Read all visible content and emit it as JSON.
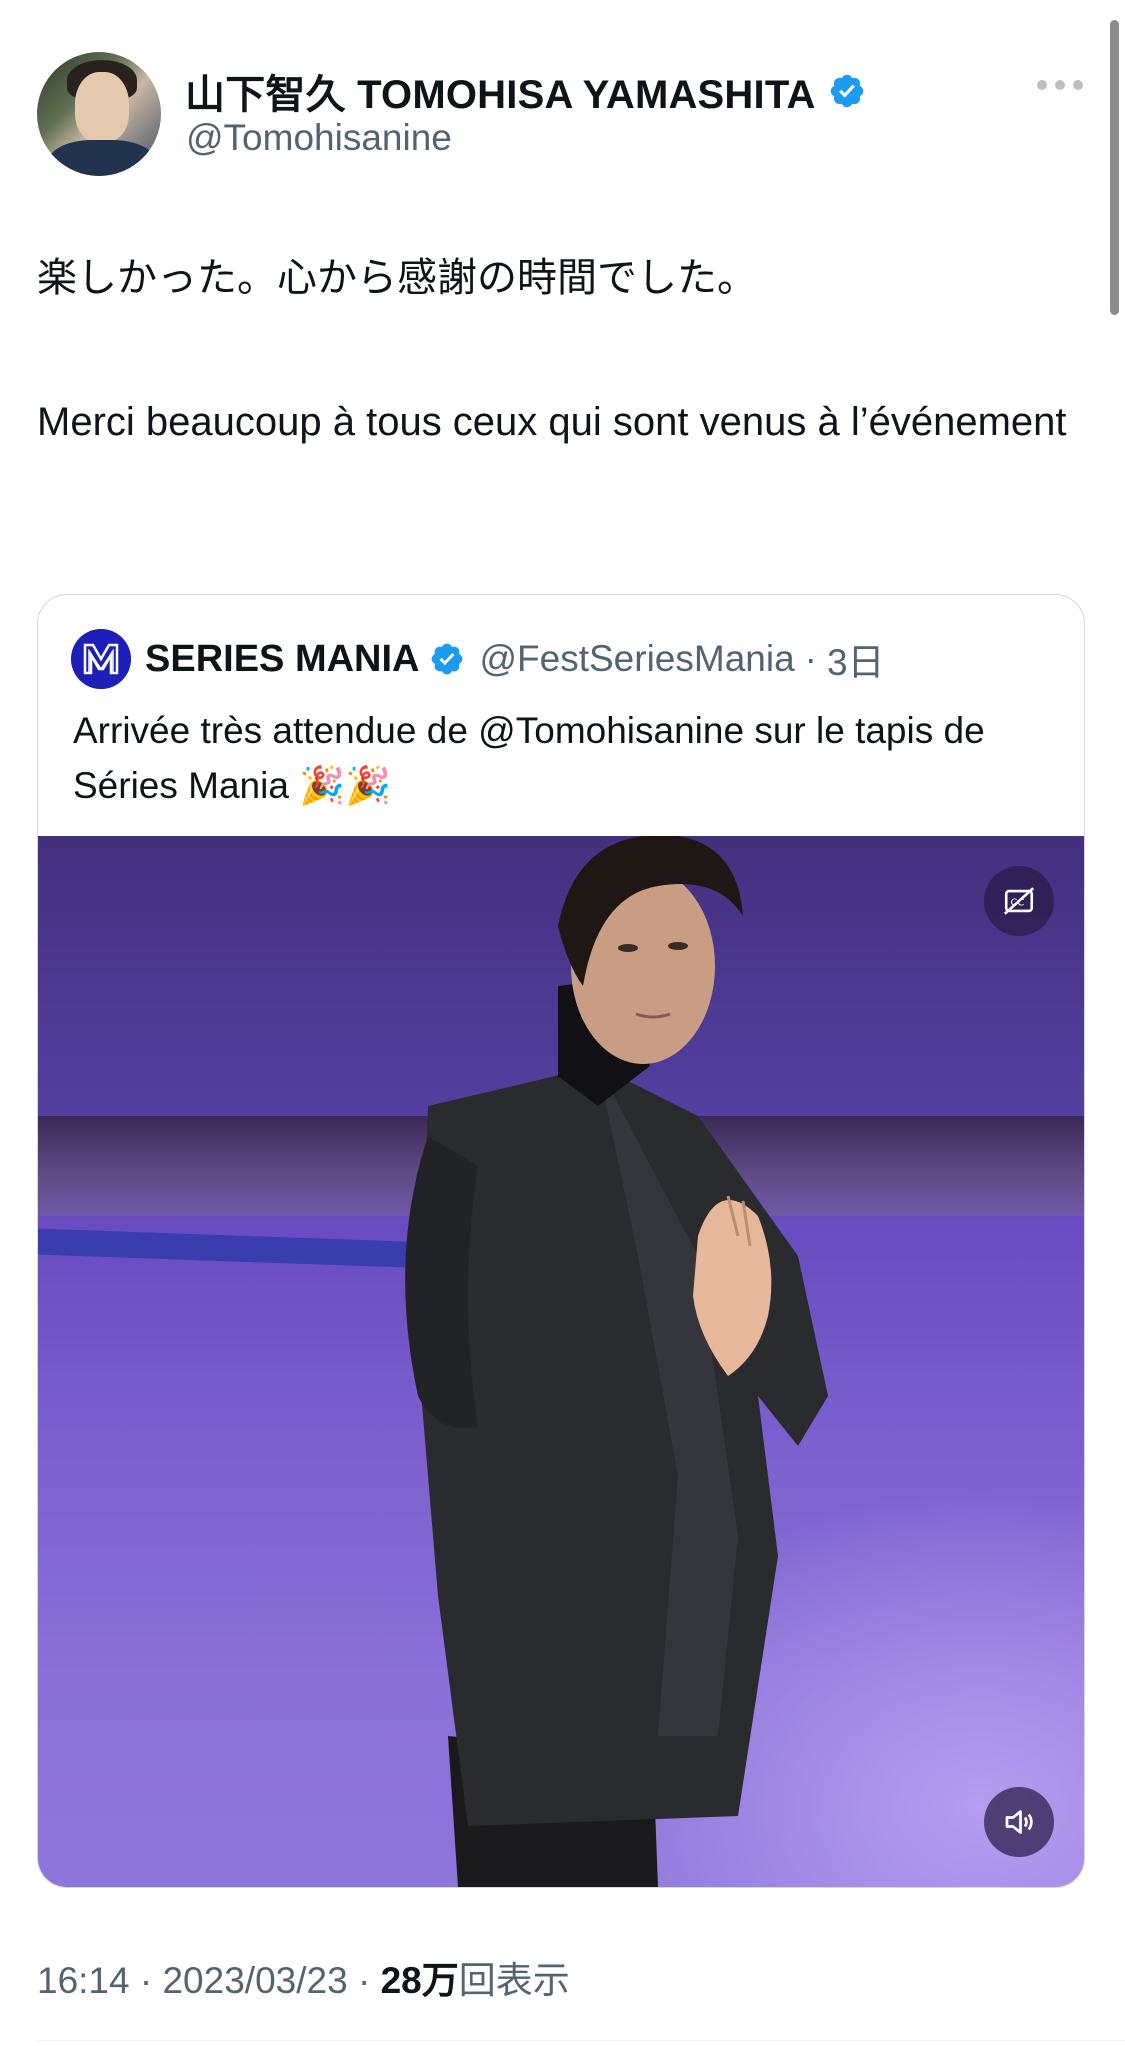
{
  "author": {
    "display_name": "山下智久 TOMOHISA YAMASHITA",
    "handle": "@Tomohisanine",
    "verified": true,
    "avatar_icon": "profile-photo"
  },
  "tweet": {
    "line1": "楽しかった。心から感謝の時間でした。",
    "line2": "Merci beaucoup à tous ceux qui sont venus à l’événement"
  },
  "quoted": {
    "display_name": "SERIES MANIA",
    "handle": "@FestSeriesMania",
    "separator": "·",
    "time": "3日",
    "text": "Arrivée très attendue de @Tomohisanine sur le tapis de Séries Mania 🎉🎉",
    "video_controls": {
      "captions_icon": "captions-off-icon",
      "sound_icon": "volume-muted-icon"
    }
  },
  "meta": {
    "time": "16:14",
    "sep1": " · ",
    "date": "2023/03/23",
    "sep2": " · ",
    "views": "28万",
    "views_label": "回表示"
  },
  "colors": {
    "verified_blue": "#1d9bf0",
    "secondary_text": "#536471",
    "series_mania_brand": "#1d1fb8"
  }
}
